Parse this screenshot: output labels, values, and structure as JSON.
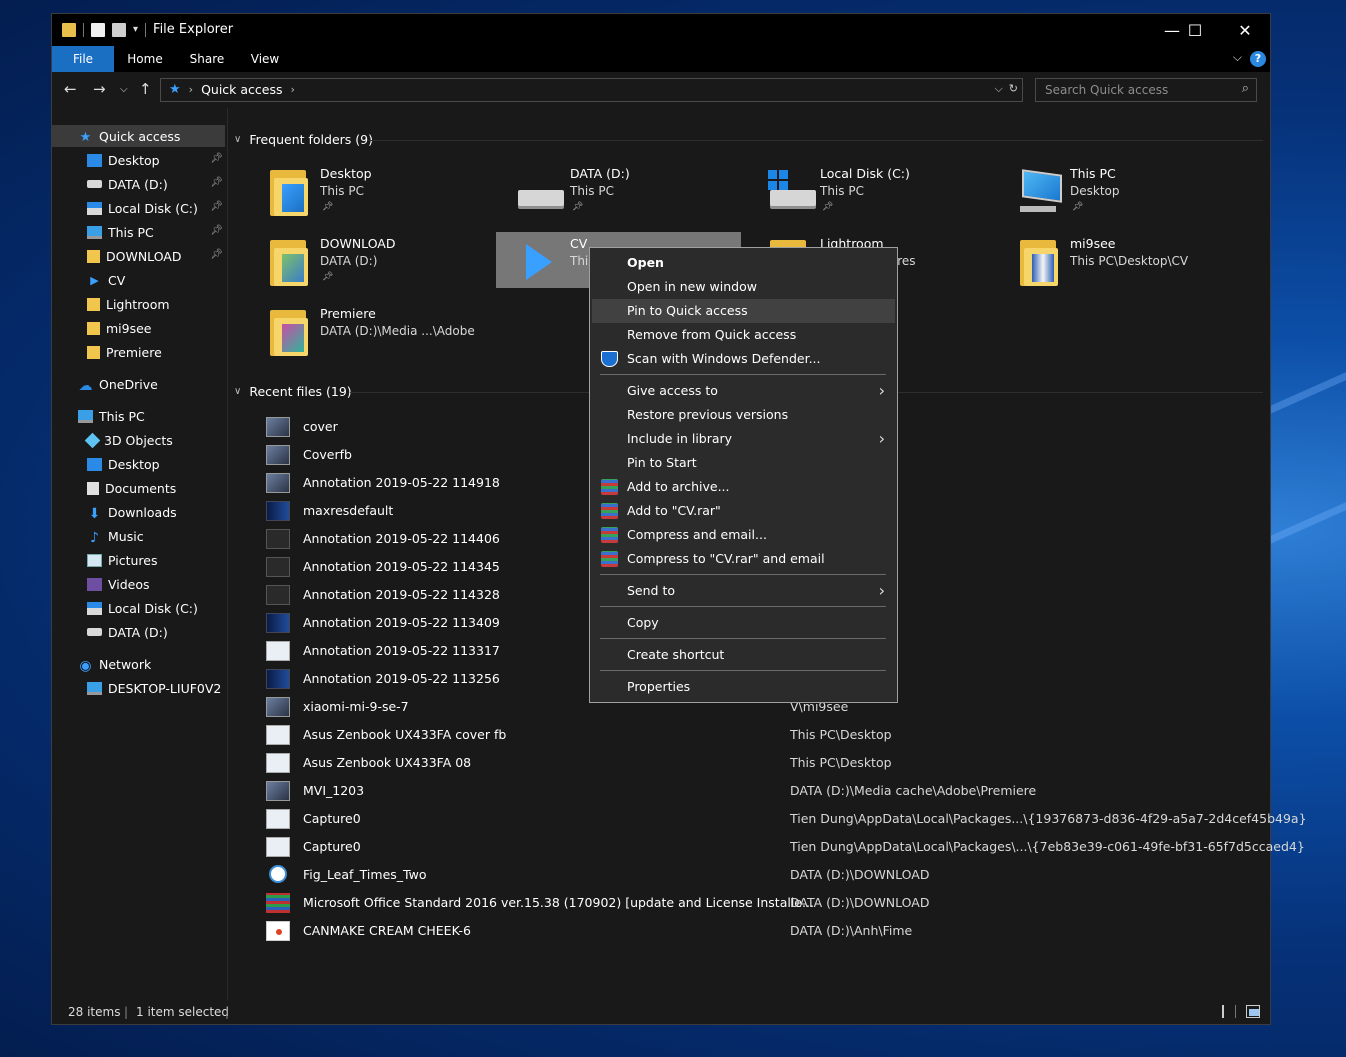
{
  "window": {
    "title": "File Explorer"
  },
  "ribbon": {
    "tabs": [
      "File",
      "Home",
      "Share",
      "View"
    ],
    "help": "?"
  },
  "address": {
    "crumb": "Quick access"
  },
  "search": {
    "placeholder": "Search Quick access"
  },
  "sidebar": {
    "quick_access": "Quick access",
    "pinned": [
      "Desktop",
      "DATA (D:)",
      "Local Disk (C:)",
      "This PC",
      "DOWNLOAD"
    ],
    "recent": [
      "CV",
      "Lightroom",
      "mi9see",
      "Premiere"
    ],
    "onedrive": "OneDrive",
    "this_pc": "This PC",
    "this_pc_items": [
      "3D Objects",
      "Desktop",
      "Documents",
      "Downloads",
      "Music",
      "Pictures",
      "Videos",
      "Local Disk (C:)",
      "DATA (D:)"
    ],
    "network": "Network",
    "network_items": [
      "DESKTOP-LIUF0V2"
    ]
  },
  "frequent": {
    "header": "Frequent folders (9)",
    "tiles": [
      {
        "name": "Desktop",
        "sub": "This PC",
        "icon": "folder-desktop-icon"
      },
      {
        "name": "DATA (D:)",
        "sub": "This PC",
        "icon": "drive-icon"
      },
      {
        "name": "Local Disk (C:)",
        "sub": "This PC",
        "icon": "windows-drive-icon"
      },
      {
        "name": "This PC",
        "sub": "Desktop",
        "icon": "computer-icon"
      },
      {
        "name": "DOWNLOAD",
        "sub": "DATA (D:)",
        "icon": "folder-icon"
      },
      {
        "name": "CV",
        "sub": "This PC\\Deskt...",
        "icon": "cv-folder-icon"
      },
      {
        "name": "Lightroom",
        "sub": "This PC\\Pictures",
        "icon": "folder-icon"
      },
      {
        "name": "mi9see",
        "sub": "This PC\\Desktop\\CV",
        "icon": "folder-icon"
      },
      {
        "name": "Premiere",
        "sub": "DATA (D:)\\Media ...\\Adobe",
        "icon": "folder-icon"
      }
    ]
  },
  "recent_files": {
    "header": "Recent files (19)",
    "rows": [
      {
        "name": "cover",
        "location": ""
      },
      {
        "name": "Coverfb",
        "location": ""
      },
      {
        "name": "Annotation 2019-05-22 114918",
        "location": ""
      },
      {
        "name": "maxresdefault",
        "location": ""
      },
      {
        "name": "Annotation 2019-05-22 114406",
        "location": ""
      },
      {
        "name": "Annotation 2019-05-22 114345",
        "location": ""
      },
      {
        "name": "Annotation 2019-05-22 114328",
        "location": ""
      },
      {
        "name": "Annotation 2019-05-22 113409",
        "location": ""
      },
      {
        "name": "Annotation 2019-05-22 113317",
        "location": ""
      },
      {
        "name": "Annotation 2019-05-22 113256",
        "location": ""
      },
      {
        "name": "xiaomi-mi-9-se-7",
        "location": "V\\mi9see"
      },
      {
        "name": "Asus Zenbook UX433FA cover fb",
        "location": "This PC\\Desktop"
      },
      {
        "name": "Asus Zenbook UX433FA 08",
        "location": "This PC\\Desktop"
      },
      {
        "name": "MVI_1203",
        "location": "DATA (D:)\\Media cache\\Adobe\\Premiere"
      },
      {
        "name": "Capture0",
        "location": "Tien Dung\\AppData\\Local\\Packages...\\{19376873-d836-4f29-a5a7-2d4cef45b49a}"
      },
      {
        "name": "Capture0",
        "location": "Tien Dung\\AppData\\Local\\Packages\\...\\{7eb83e39-c061-49fe-bf31-65f7d5ccaed4}"
      },
      {
        "name": "Fig_Leaf_Times_Two",
        "location": "DATA (D:)\\DOWNLOAD"
      },
      {
        "name": "Microsoft Office Standard 2016 ver.15.38 (170902) [update and License Installe...",
        "location": "DATA (D:)\\DOWNLOAD"
      },
      {
        "name": "CANMAKE CREAM CHEEK-6",
        "location": "DATA (D:)\\Anh\\Fime"
      }
    ]
  },
  "context_menu": {
    "items": [
      "Open",
      "Open in new window",
      "Pin to Quick access",
      "Remove from Quick access",
      "Scan with Windows Defender...",
      "Give access to",
      "Restore previous versions",
      "Include in library",
      "Pin to Start",
      "Add to archive...",
      "Add to \"CV.rar\"",
      "Compress and email...",
      "Compress to \"CV.rar\" and email",
      "Send to",
      "Copy",
      "Create shortcut",
      "Properties"
    ]
  },
  "status": {
    "items": "28 items",
    "selected": "1 item selected"
  }
}
